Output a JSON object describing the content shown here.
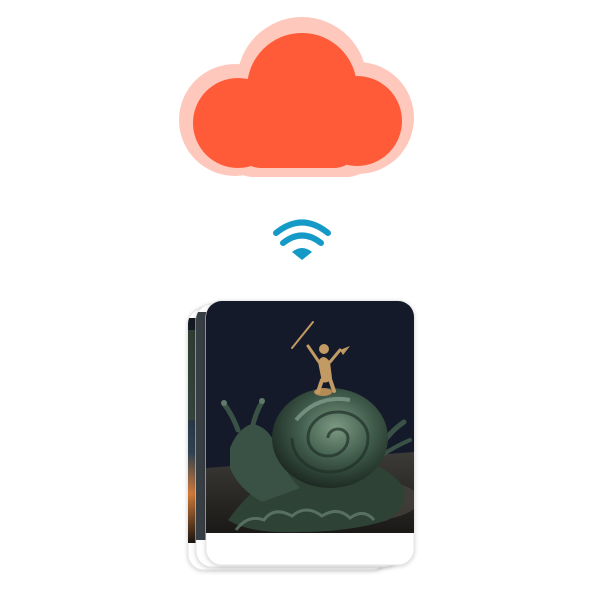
{
  "illustration": {
    "cloud_icon": "cloud-icon",
    "sync_icon": "wifi-icon",
    "photo_stack": "photo-stack"
  },
  "colors": {
    "cloud_fill": "#ff5b38",
    "cloud_halo": "#ffc8bd",
    "wifi": "#159ac7",
    "card_bg": "#ffffff",
    "card_border": "#e6e6e6",
    "photo_dark": "#141a2a",
    "bronze_green": "#3f5a4a",
    "bronze_highlight": "#7c9a83",
    "gold_figure": "#c29a63"
  }
}
